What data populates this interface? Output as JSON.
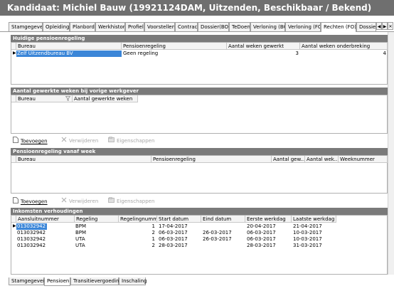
{
  "window": {
    "title": "Kandidaat: Michiel Bauw (19921124DAM, Uitzenden, Beschikbaar / Bekend)"
  },
  "tabs": [
    {
      "label": "Stamgegeven"
    },
    {
      "label": "Opleiding"
    },
    {
      "label": "Planbord"
    },
    {
      "label": "Werkhistorie"
    },
    {
      "label": "Profiel"
    },
    {
      "label": "Voorstellen"
    },
    {
      "label": "Contract"
    },
    {
      "label": "Dossier(BO)"
    },
    {
      "label": "TeDoen"
    },
    {
      "label": "Verloning (BO)"
    },
    {
      "label": "Verloning (FO)"
    },
    {
      "label": "Rechten (FO)"
    },
    {
      "label": "Dossier"
    }
  ],
  "huidige": {
    "title": "Huidige pensioenregeling",
    "columns": [
      "Bureau",
      "Pensioenregeling",
      "Aantal weken gewerkt",
      "Aantal weken onderbreking"
    ],
    "rows": [
      {
        "bureau": "Zelf Uitzendbureau BV",
        "regeling": "Geen regeling",
        "weken": "3",
        "onderbreking": "4"
      }
    ]
  },
  "vorige": {
    "title": "Aantal gewerkte weken bij vorige werkgever",
    "columns": [
      "Bureau",
      "Aantal gewerkte weken"
    ],
    "filter_icon": "funnel-icon"
  },
  "actions1": {
    "add": "Toevoegen",
    "remove": "Verwijderen",
    "props": "Eigenschappen"
  },
  "vanafweek": {
    "title": "Pensioenregeling vanaf week",
    "columns": [
      "Bureau",
      "Pensioenregeling",
      "Aantal gew...",
      "Aantal wek...",
      "Weeknummer"
    ]
  },
  "actions2": {
    "add": "Toevoegen",
    "remove": "Verwijderen",
    "props": "Eigenschappen"
  },
  "inkomsten": {
    "title": "Inkomsten verhoudingen",
    "columns": [
      "Aansluitnummer",
      "Regeling",
      "Regelingnummer",
      "Start datum",
      "Eind datum",
      "Eerste werkdag",
      "Laatste werkdag"
    ],
    "rows": [
      {
        "aansluit": "013032942",
        "regeling": "BPM",
        "nummer": "1",
        "start": "17-04-2017",
        "eind": "",
        "eerste": "20-04-2017",
        "laatste": "21-04-2017"
      },
      {
        "aansluit": "013032942",
        "regeling": "BPM",
        "nummer": "2",
        "start": "06-03-2017",
        "eind": "26-03-2017",
        "eerste": "06-03-2017",
        "laatste": "10-03-2017"
      },
      {
        "aansluit": "013032942",
        "regeling": "UTA",
        "nummer": "1",
        "start": "06-03-2017",
        "eind": "26-03-2017",
        "eerste": "06-03-2017",
        "laatste": "10-03-2017"
      },
      {
        "aansluit": "013032942",
        "regeling": "UTA",
        "nummer": "2",
        "start": "28-03-2017",
        "eind": "",
        "eerste": "28-03-2017",
        "laatste": "31-03-2017"
      }
    ]
  },
  "bottom_tabs": [
    {
      "label": "Stamgegeven"
    },
    {
      "label": "Pensioen"
    },
    {
      "label": "Transitievergoeding"
    },
    {
      "label": "Inschaling"
    }
  ]
}
